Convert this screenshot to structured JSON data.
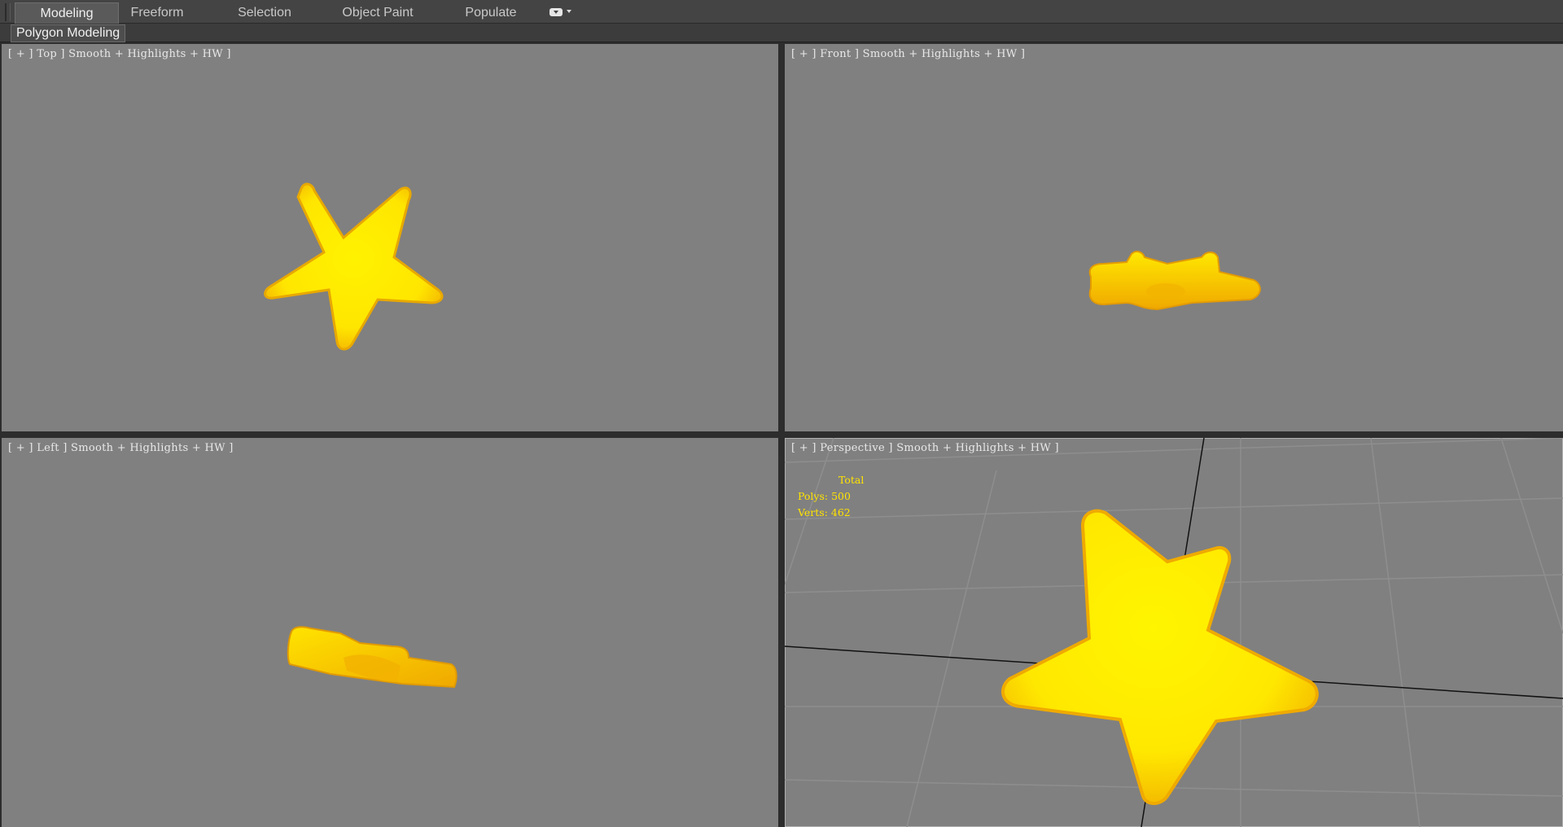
{
  "ribbon": {
    "tabs": [
      {
        "label": "Modeling",
        "active": true
      },
      {
        "label": "Freeform",
        "active": false
      },
      {
        "label": "Selection",
        "active": false
      },
      {
        "label": "Object Paint",
        "active": false
      },
      {
        "label": "Populate",
        "active": false
      }
    ],
    "menu_icon": "dropdown-pill-icon",
    "sub_tab": "Polygon Modeling"
  },
  "viewports": {
    "top": {
      "label": "[ + ] Top ] Smooth + Highlights + HW ]"
    },
    "front": {
      "label": "[ + ] Front ] Smooth + Highlights + HW ]"
    },
    "left": {
      "label": "[ + ] Left ] Smooth + Highlights + HW ]"
    },
    "perspective": {
      "label": "[ + ] Perspective ] Smooth + Highlights + HW ]",
      "stats": {
        "total_label": "Total",
        "polys": "Polys: 500",
        "verts": "Verts: 462"
      }
    }
  },
  "colors": {
    "viewport_bg": "#808080",
    "object": "#ffe800",
    "object_shade": "#f2b800",
    "stats_text": "#ffe300"
  }
}
